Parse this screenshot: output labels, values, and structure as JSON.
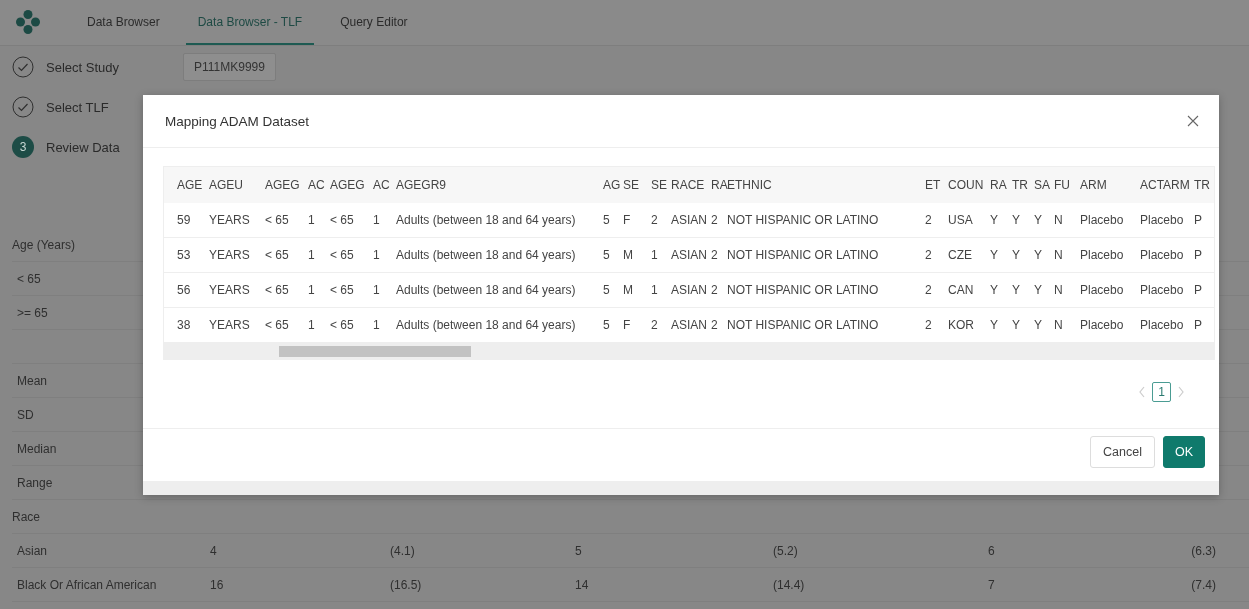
{
  "nav": {
    "tabs": [
      {
        "label": "Data Browser",
        "selected": false
      },
      {
        "label": "Data Browser - TLF",
        "selected": true
      },
      {
        "label": "Query Editor",
        "selected": false
      }
    ]
  },
  "steps": [
    {
      "label": "Select Study",
      "done": true
    },
    {
      "label": "Select TLF",
      "done": true
    },
    {
      "label": "Review Data",
      "done": false,
      "number": "3"
    }
  ],
  "study_field": {
    "value": "P111MK9999"
  },
  "summary_table": {
    "rows": [
      {
        "kind": "group",
        "label": "Age (Years)"
      },
      {
        "kind": "item",
        "label": "< 65"
      },
      {
        "kind": "item",
        "label": ">= 65"
      },
      {
        "kind": "blank"
      },
      {
        "kind": "item",
        "label": "Mean"
      },
      {
        "kind": "item",
        "label": "SD"
      },
      {
        "kind": "item",
        "label": "Median"
      },
      {
        "kind": "item",
        "label": "Range"
      },
      {
        "kind": "group",
        "label": "Race"
      },
      {
        "kind": "item",
        "label": "Asian",
        "cells": [
          "4",
          "(4.1)",
          "5",
          "(5.2)",
          "6",
          "(6.3)"
        ]
      },
      {
        "kind": "item",
        "label": "Black Or African American",
        "cells": [
          "16",
          "(16.5)",
          "14",
          "(14.4)",
          "7",
          "(7.4)"
        ]
      }
    ]
  },
  "dialog": {
    "title": "Mapping ADAM Dataset",
    "columns": [
      "AGE",
      "AGEU",
      "AGEG",
      "AC",
      "AGEG",
      "AC",
      "AGEGR9",
      "AG",
      "SE",
      "SE",
      "RACE",
      "RA",
      "ETHNIC",
      "ET",
      "COUN",
      "RA",
      "TR",
      "SA",
      "FU",
      "ARM",
      "ACTARM",
      "TR"
    ],
    "rows": [
      [
        "59",
        "YEARS",
        "< 65",
        "1",
        "< 65",
        "1",
        "Adults (between 18 and 64 years)",
        "5",
        "F",
        "2",
        "ASIAN",
        "2",
        "NOT HISPANIC OR LATINO",
        "2",
        "USA",
        "Y",
        "Y",
        "Y",
        "N",
        "Placebo",
        "Placebo",
        "P"
      ],
      [
        "53",
        "YEARS",
        "< 65",
        "1",
        "< 65",
        "1",
        "Adults (between 18 and 64 years)",
        "5",
        "M",
        "1",
        "ASIAN",
        "2",
        "NOT HISPANIC OR LATINO",
        "2",
        "CZE",
        "Y",
        "Y",
        "Y",
        "N",
        "Placebo",
        "Placebo",
        "P"
      ],
      [
        "56",
        "YEARS",
        "< 65",
        "1",
        "< 65",
        "1",
        "Adults (between 18 and 64 years)",
        "5",
        "M",
        "1",
        "ASIAN",
        "2",
        "NOT HISPANIC OR LATINO",
        "2",
        "CAN",
        "Y",
        "Y",
        "Y",
        "N",
        "Placebo",
        "Placebo",
        "P"
      ],
      [
        "38",
        "YEARS",
        "< 65",
        "1",
        "< 65",
        "1",
        "Adults (between 18 and 64 years)",
        "5",
        "F",
        "2",
        "ASIAN",
        "2",
        "NOT HISPANIC OR LATINO",
        "2",
        "KOR",
        "Y",
        "Y",
        "Y",
        "N",
        "Placebo",
        "Placebo",
        "P"
      ]
    ],
    "pagination": {
      "pages": [
        {
          "label": "1",
          "selected": true
        }
      ]
    },
    "buttons": [
      {
        "label": "Cancel",
        "kind": "secondary"
      },
      {
        "label": "OK",
        "kind": "primary"
      }
    ]
  }
}
